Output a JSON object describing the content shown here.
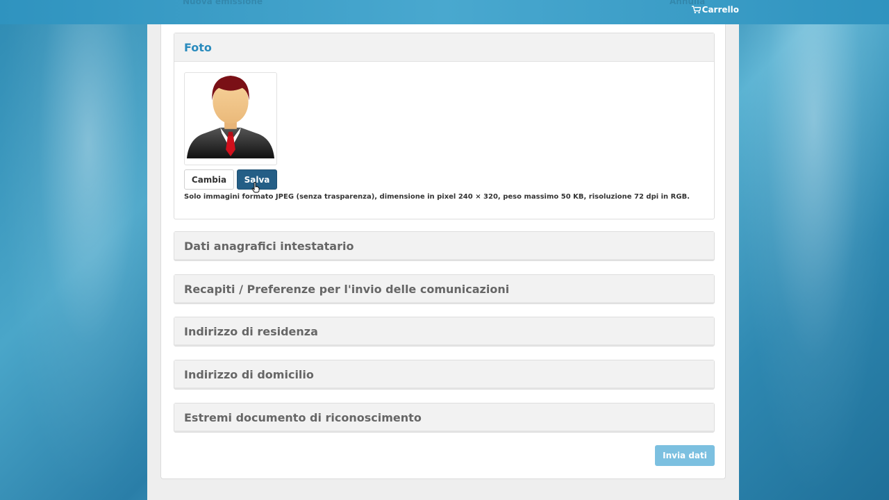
{
  "header": {
    "left_text": "Nuova emissione",
    "right_text": "Annulla",
    "cart_label": "Carrello",
    "cart_icon": "cart-icon"
  },
  "photo_section": {
    "title": "Foto",
    "avatar_icon": "person-avatar",
    "change_label": "Cambia",
    "save_label": "Salva",
    "note": "Solo immagini formato JPEG (senza trasparenza), dimensione in pixel 240 × 320, peso massimo 50 KB, risoluzione 72 dpi in RGB."
  },
  "sections": [
    {
      "title": "Dati anagrafici intestatario"
    },
    {
      "title": "Recapiti / Preferenze per l'invio delle comunicazioni"
    },
    {
      "title": "Indirizzo di residenza"
    },
    {
      "title": "Indirizzo di domicilio"
    },
    {
      "title": "Estremi documento di riconoscimento"
    }
  ],
  "submit_label": "Invia dati",
  "colors": {
    "accent_blue": "#2a8bbd",
    "save_button": "#245e86",
    "submit_button": "#7cc0e0"
  }
}
